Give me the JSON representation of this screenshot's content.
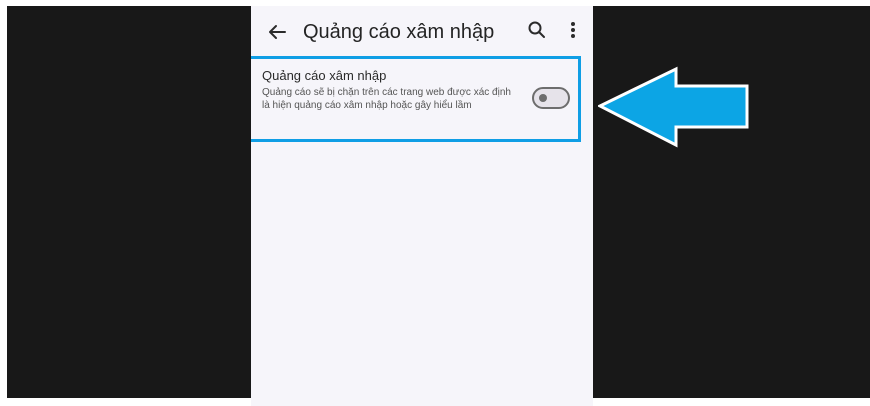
{
  "app_bar": {
    "title": "Quảng cáo xâm nhập",
    "back_icon": "arrow-back-icon",
    "search_icon": "search-icon",
    "more_icon": "more-vert-icon"
  },
  "setting": {
    "title": "Quảng cáo xâm nhập",
    "summary": "Quảng cáo sẽ bị chặn trên các trang web được xác định là hiện quảng cáo xâm nhập hoặc gây hiểu lầm",
    "toggle_state": "off"
  },
  "colors": {
    "highlight": "#0f9ee5",
    "arrow": "#0ca5e5",
    "arrow_outline": "#ffffff",
    "backdrop": "#181818",
    "screen_background": "#f6f5fa"
  },
  "annotation": {
    "arrow_icon": "arrow-left-icon"
  }
}
